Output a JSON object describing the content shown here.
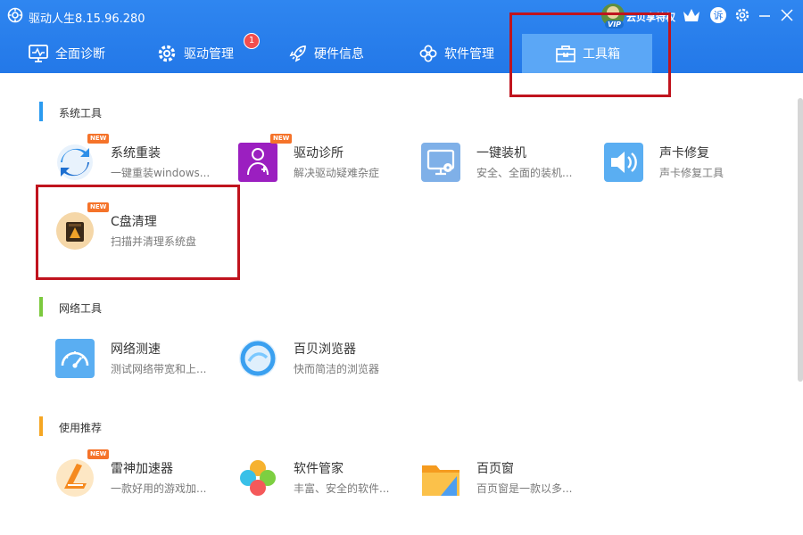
{
  "app": {
    "title": "驱动人生8.15.96.280",
    "promo_text": "云贝享特权",
    "vip_label": "VIP"
  },
  "colors": {
    "header": "#2f86f0",
    "active_tab": "#5ba7f6",
    "badge": "#f24d4d",
    "highlight": "#c0141e"
  },
  "tabs": [
    {
      "label": "全面诊断",
      "icon": "monitor-pulse-icon"
    },
    {
      "label": "驱动管理",
      "icon": "gear-icon",
      "badge": "1"
    },
    {
      "label": "硬件信息",
      "icon": "rocket-icon"
    },
    {
      "label": "软件管理",
      "icon": "flower-icon"
    },
    {
      "label": "工具箱",
      "icon": "toolbox-icon",
      "active": true
    }
  ],
  "titlebar_buttons": [
    "crown-icon",
    "feedback-icon",
    "settings-icon",
    "minimize-icon",
    "close-icon"
  ],
  "feedback_label": "诉",
  "sections": [
    {
      "title": "系统工具",
      "tools": [
        {
          "name": "系统重装",
          "desc": "一键重装windows...",
          "new": true,
          "icon": "reinstall-icon"
        },
        {
          "name": "驱动诊所",
          "desc": "解决驱动疑难杂症",
          "new": true,
          "icon": "doctor-icon"
        },
        {
          "name": "一键装机",
          "desc": "安全、全面的装机...",
          "new": false,
          "icon": "install-icon"
        },
        {
          "name": "声卡修复",
          "desc": "声卡修复工具",
          "new": false,
          "icon": "speaker-icon"
        },
        {
          "name": "C盘清理",
          "desc": "扫描并清理系统盘",
          "new": true,
          "icon": "disk-clean-icon"
        }
      ]
    },
    {
      "title": "网络工具",
      "tools": [
        {
          "name": "网络测速",
          "desc": "测试网络带宽和上...",
          "new": false,
          "icon": "speedometer-icon"
        },
        {
          "name": "百贝浏览器",
          "desc": "快而简洁的浏览器",
          "new": false,
          "icon": "browser-icon"
        }
      ]
    },
    {
      "title": "使用推荐",
      "tools": [
        {
          "name": "雷神加速器",
          "desc": "一款好用的游戏加...",
          "new": true,
          "icon": "leishen-icon"
        },
        {
          "name": "软件管家",
          "desc": "丰富、安全的软件...",
          "new": false,
          "icon": "software-manager-icon"
        },
        {
          "name": "百页窗",
          "desc": "百页窗是一款以多...",
          "new": false,
          "icon": "folder-icon"
        }
      ]
    }
  ],
  "new_label": "NEW"
}
